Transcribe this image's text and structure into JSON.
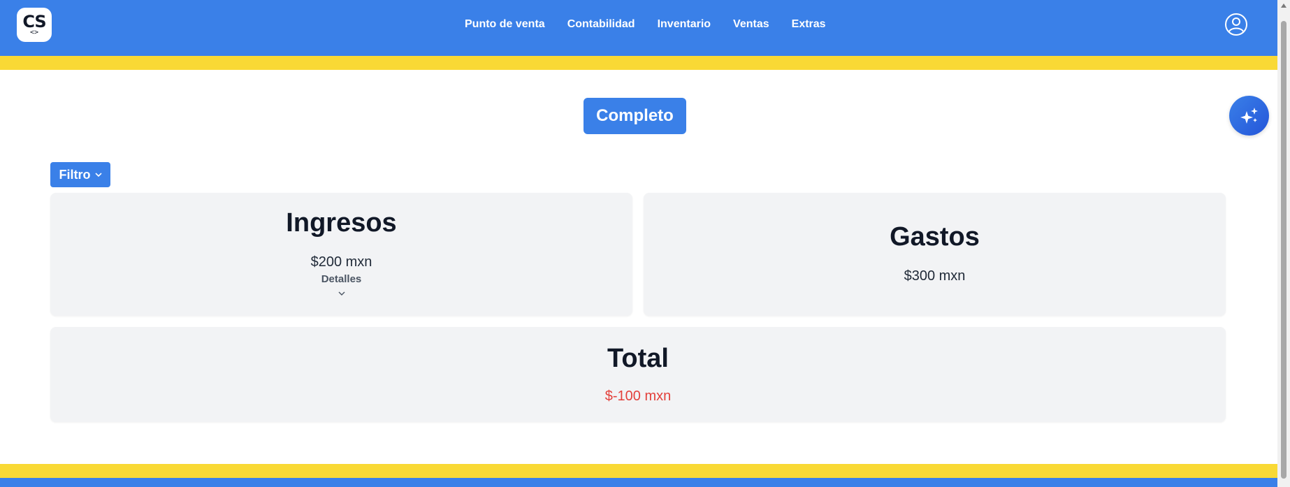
{
  "brand": {
    "logo_text": "CS",
    "logo_sub": "<>"
  },
  "nav": {
    "items": [
      {
        "label": "Punto de venta"
      },
      {
        "label": "Contabilidad"
      },
      {
        "label": "Inventario"
      },
      {
        "label": "Ventas"
      },
      {
        "label": "Extras"
      }
    ],
    "user_icon": "user-circle-icon"
  },
  "main": {
    "mode_button": "Completo",
    "ai_button_icon": "sparkles-icon",
    "filter_button": "Filtro",
    "cards": {
      "income": {
        "title": "Ingresos",
        "amount": "$200 mxn",
        "details_label": "Detalles"
      },
      "expense": {
        "title": "Gastos",
        "amount": "$300 mxn"
      },
      "total": {
        "title": "Total",
        "amount": "$-100 mxn"
      }
    }
  },
  "colors": {
    "primary": "#3a80e8",
    "accent": "#f9d935",
    "card_bg": "#f2f3f5",
    "negative": "#e3403b"
  }
}
